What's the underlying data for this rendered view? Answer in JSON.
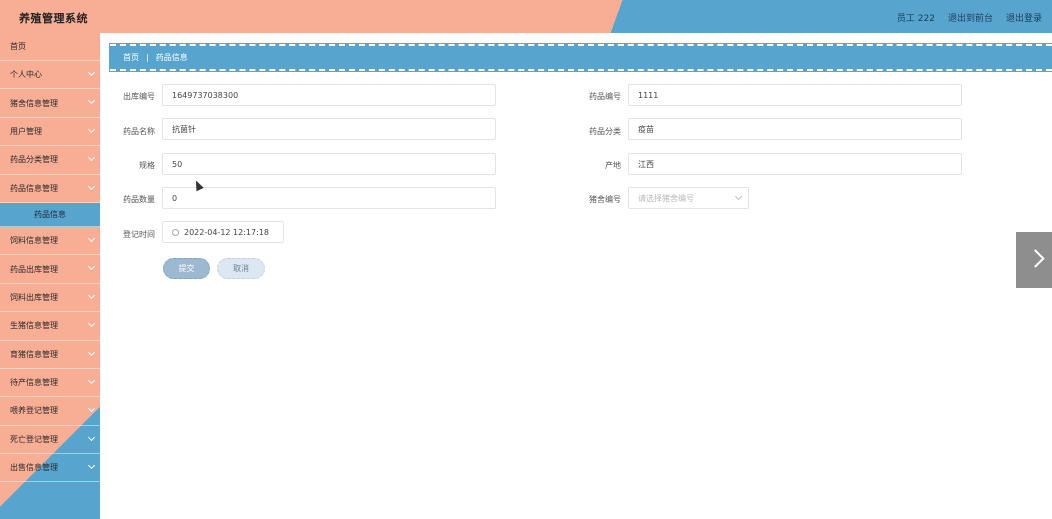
{
  "header": {
    "title": "养殖管理系统",
    "user": "员工 222",
    "front_link": "退出到前台",
    "logout_link": "退出登录"
  },
  "sidebar": {
    "items": [
      {
        "label": "首页",
        "has_chevron": false
      },
      {
        "label": "个人中心",
        "has_chevron": true
      },
      {
        "label": "猪舍信息管理",
        "has_chevron": true
      },
      {
        "label": "用户管理",
        "has_chevron": true
      },
      {
        "label": "药品分类管理",
        "has_chevron": true
      },
      {
        "label": "药品信息管理",
        "has_chevron": true
      },
      {
        "label": "药品信息",
        "has_chevron": false,
        "active_sub": true
      },
      {
        "label": "饲料信息管理",
        "has_chevron": true
      },
      {
        "label": "药品出库管理",
        "has_chevron": true
      },
      {
        "label": "饲料出库管理",
        "has_chevron": true
      },
      {
        "label": "生猪信息管理",
        "has_chevron": true
      },
      {
        "label": "育猪信息管理",
        "has_chevron": true
      },
      {
        "label": "待产信息管理",
        "has_chevron": true
      },
      {
        "label": "喂养登记管理",
        "has_chevron": true
      },
      {
        "label": "死亡登记管理",
        "has_chevron": true
      },
      {
        "label": "出售信息管理",
        "has_chevron": true
      }
    ]
  },
  "breadcrumb": {
    "home": "首页",
    "separator": "|",
    "current": "药品信息"
  },
  "form": {
    "outbound_no_label": "出库编号",
    "outbound_no_value": "1649737038300",
    "drug_no_label": "药品编号",
    "drug_no_value": "1111",
    "drug_name_label": "药品名称",
    "drug_name_value": "抗菌针",
    "drug_category_label": "药品分类",
    "drug_category_value": "疫苗",
    "spec_label": "规格",
    "spec_value": "50",
    "origin_label": "产地",
    "origin_value": "江西",
    "quantity_label": "药品数量",
    "quantity_value": "0",
    "pigpen_no_label": "猪舍编号",
    "pigpen_no_placeholder": "请选择猪舍编号",
    "reg_time_label": "登记时间",
    "reg_time_value": "2022-04-12 12:17:18",
    "submit_label": "提交",
    "cancel_label": "取消"
  },
  "colors": {
    "salmon": "#f8ae94",
    "blue": "#57a5cf"
  }
}
